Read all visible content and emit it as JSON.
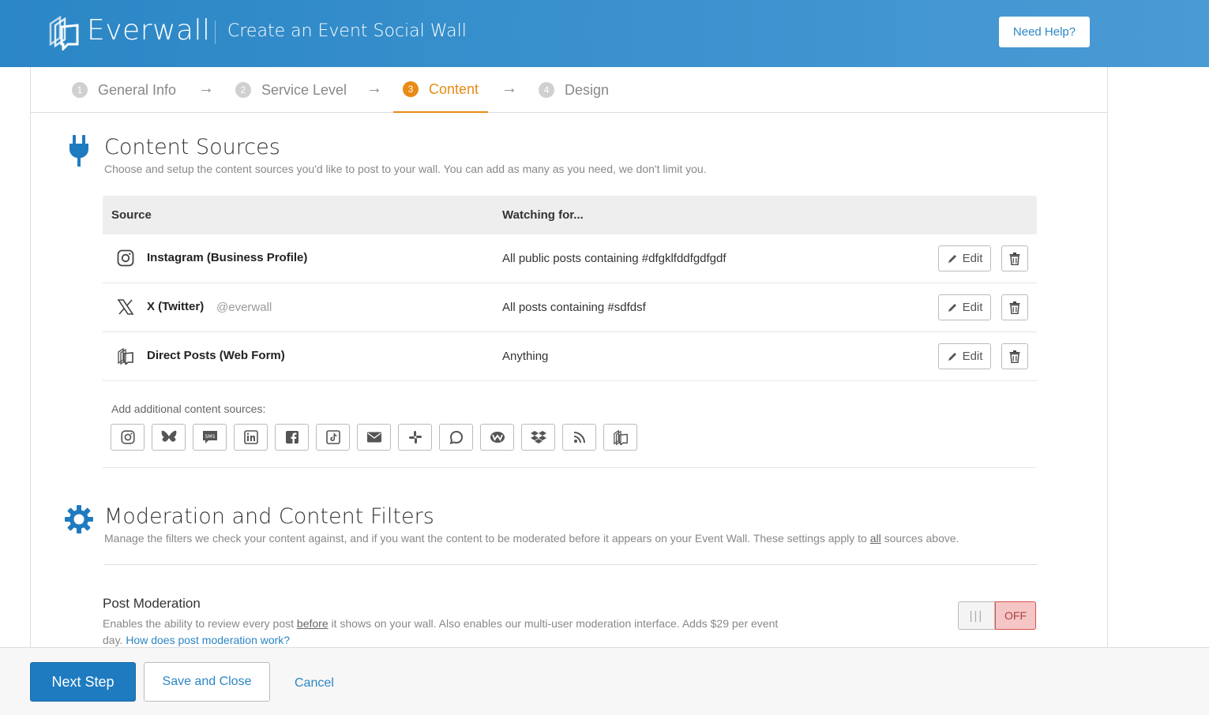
{
  "header": {
    "brand": "Everwall",
    "title": "Create an Event Social Wall",
    "help_label": "Need Help?"
  },
  "steps": [
    {
      "num": "1",
      "label": "General Info",
      "active": false
    },
    {
      "num": "2",
      "label": "Service Level",
      "active": false
    },
    {
      "num": "3",
      "label": "Content",
      "active": true
    },
    {
      "num": "4",
      "label": "Design",
      "active": false
    }
  ],
  "step_arrow": "→",
  "content_sources": {
    "title": "Content Sources",
    "description": "Choose and setup the content sources you'd like to post to your wall. You can add as many as you need, we don't limit you.",
    "table": {
      "col_source": "Source",
      "col_watching": "Watching for...",
      "rows": [
        {
          "icon": "instagram-icon",
          "name": "Instagram (Business Profile)",
          "handle": "",
          "watching": "All public posts containing #dfgklfddfgdfgdf",
          "edit_label": "Edit"
        },
        {
          "icon": "x-twitter-icon",
          "name": "X (Twitter)",
          "handle": "@everwall",
          "watching": "All posts containing #sdfdsf",
          "edit_label": "Edit"
        },
        {
          "icon": "direct-posts-icon",
          "name": "Direct Posts (Web Form)",
          "handle": "",
          "watching": "Anything",
          "edit_label": "Edit"
        }
      ]
    },
    "add_label": "Add additional content sources:",
    "add_sources": [
      "instagram-icon",
      "bluesky-icon",
      "sms-icon",
      "linkedin-icon",
      "facebook-icon",
      "tiktok-icon",
      "email-icon",
      "slack-icon",
      "chat-icon",
      "webex-icon",
      "dropbox-icon",
      "rss-icon",
      "direct-posts-icon"
    ]
  },
  "moderation": {
    "title": "Moderation and Content Filters",
    "desc_pre": "Manage the filters we check your content against, and if you want the content to be moderated before it appears on your Event Wall. These settings apply to ",
    "desc_u": "all",
    "desc_post": " sources above.",
    "post_moderation": {
      "title": "Post Moderation",
      "desc_pre": "Enables the ability to review every post ",
      "desc_u": "before",
      "desc_post": " it shows on your wall. Also enables our multi-user moderation interface. Adds $29 per event day. ",
      "link": "How does post moderation work?",
      "toggle_knob": "|||",
      "toggle_state": "OFF"
    }
  },
  "footer": {
    "next_label": "Next Step",
    "save_label": "Save and Close",
    "cancel_label": "Cancel"
  },
  "colors": {
    "primary": "#2b86c5",
    "accent": "#e98b15",
    "off_bg": "#f6c5c5"
  }
}
